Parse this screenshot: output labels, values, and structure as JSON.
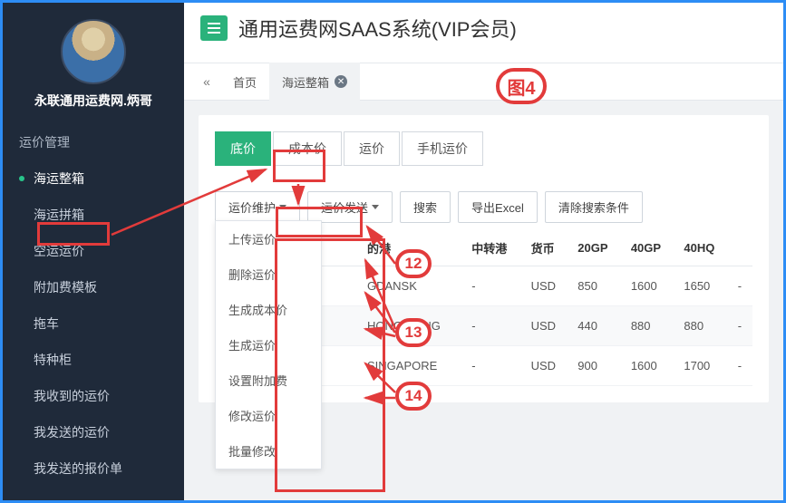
{
  "user": {
    "name": "永联通用运费网.炳哥"
  },
  "app": {
    "title": "通用运费网SAAS系统(VIP会员)"
  },
  "sidebar": {
    "section_label": "运价管理",
    "items": [
      {
        "label": "海运整箱",
        "active": true
      },
      {
        "label": "海运拼箱"
      },
      {
        "label": "空运运价"
      },
      {
        "label": "附加费模板"
      },
      {
        "label": "拖车"
      },
      {
        "label": "特种柜"
      },
      {
        "label": "我收到的运价"
      },
      {
        "label": "我发送的运价"
      },
      {
        "label": "我发送的报价单"
      }
    ]
  },
  "tabs": {
    "home": "首页",
    "active": "海运整箱"
  },
  "pills": {
    "p0": "底价",
    "p1": "成本价",
    "p2": "运价",
    "p3": "手机运价"
  },
  "toolbar": {
    "maintain": "运价维护",
    "send": "运价发送",
    "search": "搜索",
    "export": "导出Excel",
    "clear": "清除搜索条件"
  },
  "dropdown": {
    "d0": "上传运价",
    "d1": "删除运价",
    "d2": "生成成本价",
    "d3": "生成运价",
    "d4": "设置附加费",
    "d5": "修改运价",
    "d6": "批量修改"
  },
  "table": {
    "headers": {
      "dest": "的港",
      "via": "中转港",
      "cur": "货币",
      "g20": "20GP",
      "g40": "40GP",
      "hq40": "40HQ"
    },
    "rows": [
      {
        "dest": "GDANSK",
        "via": "-",
        "cur": "USD",
        "g20": "850",
        "g40": "1600",
        "hq40": "1650",
        "tail": "-"
      },
      {
        "dest": "HONG KONG",
        "via": "-",
        "cur": "USD",
        "g20": "440",
        "g40": "880",
        "hq40": "880",
        "tail": "-"
      },
      {
        "dest": "SINGAPORE",
        "via": "-",
        "cur": "USD",
        "g20": "900",
        "g40": "1600",
        "hq40": "1700",
        "tail": "-"
      }
    ]
  },
  "annotations": {
    "fig": "图4",
    "n12": "12",
    "n13": "13",
    "n14": "14"
  }
}
